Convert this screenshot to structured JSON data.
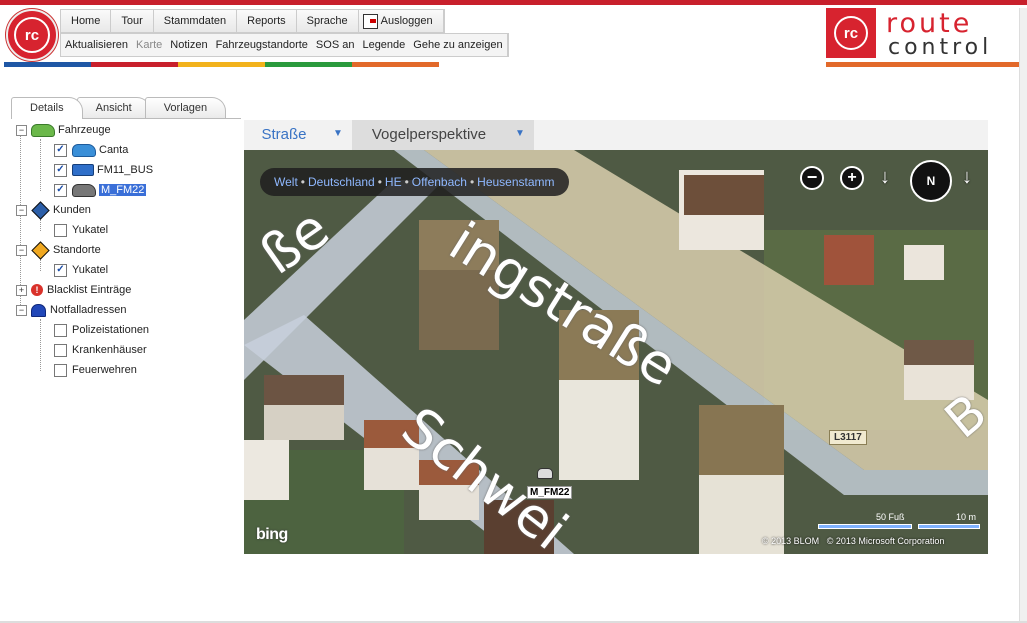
{
  "header": {
    "logo_small_text": "rc",
    "menu_top": [
      "Home",
      "Tour",
      "Stammdaten",
      "Reports",
      "Sprache"
    ],
    "logout_label": "Ausloggen",
    "menu_sub": [
      {
        "label": "Aktualisieren",
        "disabled": false
      },
      {
        "label": "Karte",
        "disabled": true
      },
      {
        "label": "Notizen",
        "disabled": false
      },
      {
        "label": "Fahrzeugstandorte",
        "disabled": false
      },
      {
        "label": "SOS an",
        "disabled": false
      },
      {
        "label": "Legende",
        "disabled": false
      },
      {
        "label": "Gehe zu anzeigen",
        "disabled": false
      }
    ],
    "brand_line1": "route",
    "brand_line2": "control",
    "brand_circle_text": "rc",
    "colorbar": [
      "#1f57a5",
      "#c8202c",
      "#f2b21c",
      "#2a9a3c",
      "#e2692a"
    ]
  },
  "tabs": [
    "Details",
    "Ansicht",
    "Vorlagen"
  ],
  "tree": {
    "groups": [
      {
        "label": "Fahrzeuge",
        "expanded": true,
        "icon": "car-icon",
        "items": [
          {
            "label": "Canta",
            "checked": true,
            "icon": "car-icon"
          },
          {
            "label": "FM11_BUS",
            "checked": true,
            "icon": "bus-icon"
          },
          {
            "label": "M_FM22",
            "checked": true,
            "icon": "car-icon",
            "selected": true
          }
        ]
      },
      {
        "label": "Kunden",
        "expanded": true,
        "icon": "customer-diamond-icon",
        "items": [
          {
            "label": "Yukatel",
            "checked": false
          }
        ]
      },
      {
        "label": "Standorte",
        "expanded": true,
        "icon": "location-diamond-icon",
        "items": [
          {
            "label": "Yukatel",
            "checked": true
          }
        ]
      },
      {
        "label": "Blacklist Einträge",
        "expanded": false,
        "icon": "warning-icon",
        "items": []
      },
      {
        "label": "Notfalladressen",
        "expanded": true,
        "icon": "siren-icon",
        "items": [
          {
            "label": "Polizeistationen",
            "checked": false
          },
          {
            "label": "Krankenhäuser",
            "checked": false
          },
          {
            "label": "Feuerwehren",
            "checked": false
          }
        ]
      }
    ]
  },
  "map": {
    "view_road": "Straße",
    "view_birdseye": "Vogelperspektive",
    "breadcrumb": [
      "Welt",
      "Deutschland",
      "HE",
      "Offenbach",
      "Heusenstamm"
    ],
    "compass_label": "N",
    "street_1": "ingstraße",
    "street_2": "Schwei",
    "street_3": "ße",
    "street_4": "B",
    "road_badge": "L3117",
    "vehicle_label": "M_FM22",
    "scale_feet": "50 Fuß",
    "scale_meters": "10 m",
    "copyright_1": "© 2013 BLOM",
    "copyright_2": "© 2013 Microsoft Corporation",
    "provider": "bing"
  }
}
